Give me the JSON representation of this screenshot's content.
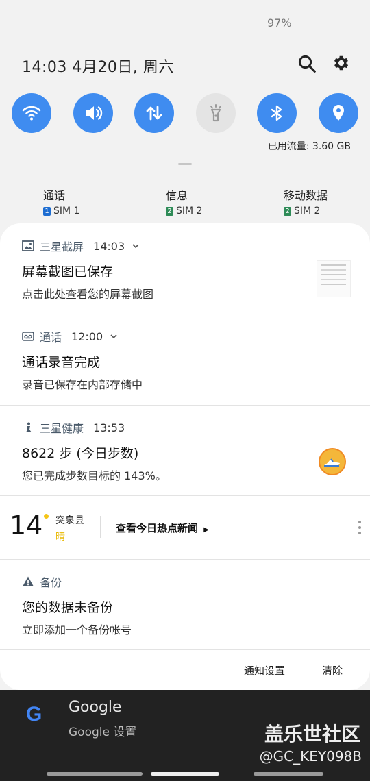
{
  "status_bar": {
    "battery": "97%"
  },
  "header": {
    "datetime": "14:03  4月20日, 周六"
  },
  "quick_settings": {
    "accent": "#3f8cf0",
    "tiles": [
      {
        "icon": "wifi-icon",
        "active": true
      },
      {
        "icon": "sound-icon",
        "active": true
      },
      {
        "icon": "mobile-data-icon",
        "active": true
      },
      {
        "icon": "flashlight-icon",
        "active": false
      },
      {
        "icon": "bluetooth-icon",
        "active": true
      },
      {
        "icon": "location-icon",
        "active": true
      }
    ],
    "data_usage": "已用流量: 3.60 GB"
  },
  "sim_settings": [
    {
      "label": "通话",
      "sim_num": "1",
      "sim": "SIM 1",
      "color": "#1d6dd1"
    },
    {
      "label": "信息",
      "sim_num": "2",
      "sim": "SIM 2",
      "color": "#2e8b57"
    },
    {
      "label": "移动数据",
      "sim_num": "2",
      "sim": "SIM 2",
      "color": "#2e8b57"
    }
  ],
  "notifications": [
    {
      "app": "三星截屏",
      "time": "14:03",
      "title": "屏幕截图已保存",
      "text": "点击此处查看您的屏幕截图"
    },
    {
      "app": "通话",
      "time": "12:00",
      "title": "通话录音完成",
      "text": "录音已保存在内部存储中"
    },
    {
      "app": "三星健康",
      "time": "13:53",
      "title": "8622 步 (今日步数)",
      "text": "您已完成步数目标的 143%。"
    }
  ],
  "weather": {
    "temp": "14",
    "city": "突泉县",
    "condition": "晴",
    "news": "查看今日热点新闻"
  },
  "backup": {
    "app": "备份",
    "title": "您的数据未备份",
    "text": "立即添加一个备份帐号"
  },
  "actions": {
    "settings": "通知设置",
    "clear": "清除"
  },
  "background_notification": {
    "title": "Google",
    "subtitle": "Google 设置"
  },
  "watermark": {
    "line1": "盖乐世社区",
    "line2": "@GC_KEY098B"
  }
}
